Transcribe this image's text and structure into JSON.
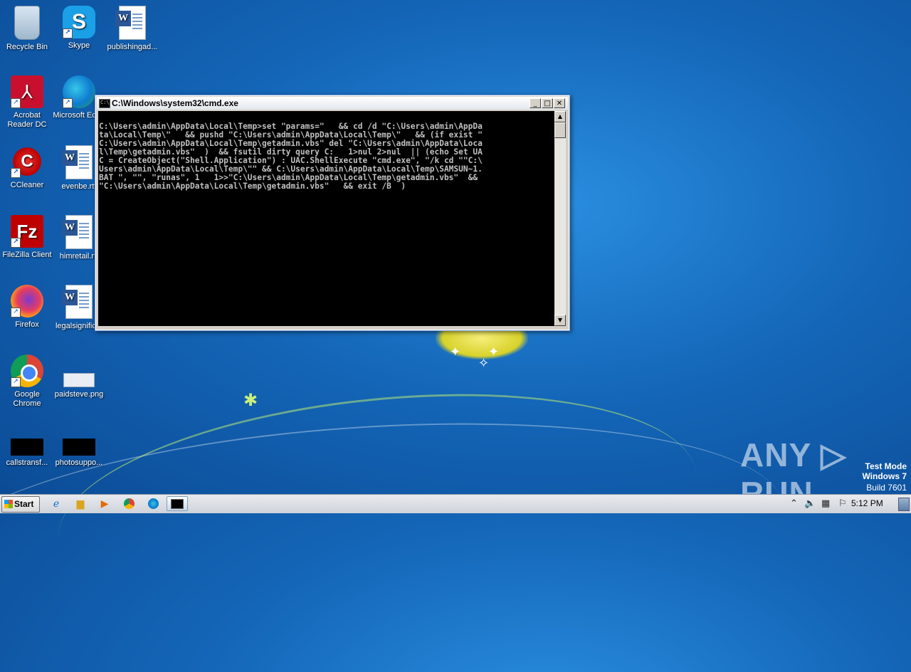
{
  "desktop": {
    "icons": [
      {
        "label": "Recycle Bin"
      },
      {
        "label": "Skype"
      },
      {
        "label": "publishingad..."
      },
      {
        "label": "Acrobat Reader DC"
      },
      {
        "label": "Microsoft Edge"
      },
      {
        "label": "CCleaner"
      },
      {
        "label": "evenbe.rtf"
      },
      {
        "label": "FileZilla Client"
      },
      {
        "label": "himretail.rtf"
      },
      {
        "label": "Firefox"
      },
      {
        "label": "legalsignific..."
      },
      {
        "label": "Google Chrome"
      },
      {
        "label": "paidsteve.png"
      },
      {
        "label": "callstransf..."
      },
      {
        "label": "photosuppo..."
      }
    ]
  },
  "cmd_window": {
    "title": "C:\\Windows\\system32\\cmd.exe",
    "icon_text": "C:\\",
    "min_label": "_",
    "max_label": "□",
    "close_label": "✕",
    "console_text": "C:\\Users\\admin\\AppData\\Local\\Temp>set \"params=\"   && cd /d \"C:\\Users\\admin\\AppDa\nta\\Local\\Temp\\\"   && pushd \"C:\\Users\\admin\\AppData\\Local\\Temp\\\"   && (if exist \"\nC:\\Users\\admin\\AppData\\Local\\Temp\\getadmin.vbs\" del \"C:\\Users\\admin\\AppData\\Loca\nl\\Temp\\getadmin.vbs\"  )  && fsutil dirty query C:   1>nul 2>nul  || (echo Set UA\nC = CreateObject(\"Shell.Application\") : UAC.ShellExecute \"cmd.exe\", \"/k cd \"\"C:\\\nUsers\\admin\\AppData\\Local\\Temp\\\"\" && C:\\Users\\admin\\AppData\\Local\\Temp\\SAMSUN~1.\nBAT \", \"\", \"runas\", 1   1>>\"C:\\Users\\admin\\AppData\\Local\\Temp\\getadmin.vbs\"  &&\n\"C:\\Users\\admin\\AppData\\Local\\Temp\\getadmin.vbs\"   && exit /B  )"
  },
  "watermark": {
    "brand": "ANY ▷ RUN",
    "mode": "Test Mode",
    "os": "Windows 7",
    "build": "Build 7601"
  },
  "taskbar": {
    "start_label": "Start",
    "clock": "5:12 PM",
    "pinned": [
      "ie-icon",
      "explorer-icon",
      "media-player-icon",
      "chrome-icon",
      "edge-icon",
      "cmd-icon"
    ]
  },
  "colors": {
    "console_bg": "#000000",
    "console_fg": "#c0c0c0",
    "desktop_bg": "#1466b8"
  }
}
